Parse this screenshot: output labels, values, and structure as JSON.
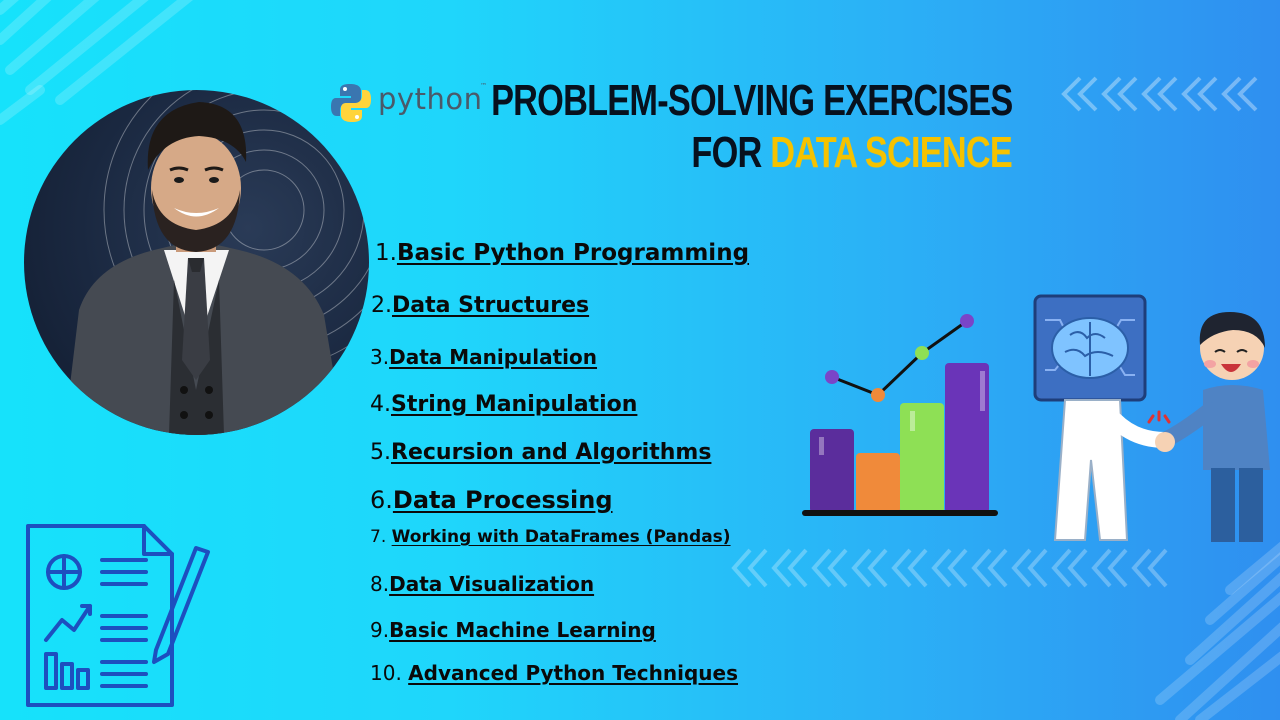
{
  "header": {
    "logo_text": "python",
    "logo_tm": "™",
    "title_line1": "PROBLEM-SOLVING EXERCISES",
    "title_line2_prefix": "FOR ",
    "title_line2_highlight": "DATA SCIENCE"
  },
  "topics": [
    {
      "num": "1.",
      "label": "Basic Python Programming"
    },
    {
      "num": "2.",
      "label": "Data Structures"
    },
    {
      "num": "3.",
      "label": "Data Manipulation"
    },
    {
      "num": "4.",
      "label": "String Manipulation"
    },
    {
      "num": "5.",
      "label": "Recursion and Algorithms"
    },
    {
      "num": "6.",
      "label": "Data Processing"
    },
    {
      "num": "7. ",
      "label": "Working with DataFrames (Pandas)"
    },
    {
      "num": "8.",
      "label": "Data Visualization"
    },
    {
      "num": "9.",
      "label": "Basic Machine Learning"
    },
    {
      "num": "10. ",
      "label": "Advanced Python Techniques"
    }
  ],
  "colors": {
    "title": "#07111e",
    "highlight": "#f5c200",
    "bar_purple": "#5b2d9c",
    "bar_orange": "#f08a3a",
    "bar_green": "#8ee055",
    "bar_violet": "#6a34b8"
  },
  "icons": [
    "python-logo-icon",
    "presenter-photo",
    "report-document-icon",
    "bar-chart-illustration",
    "ai-handshake-illustration"
  ]
}
